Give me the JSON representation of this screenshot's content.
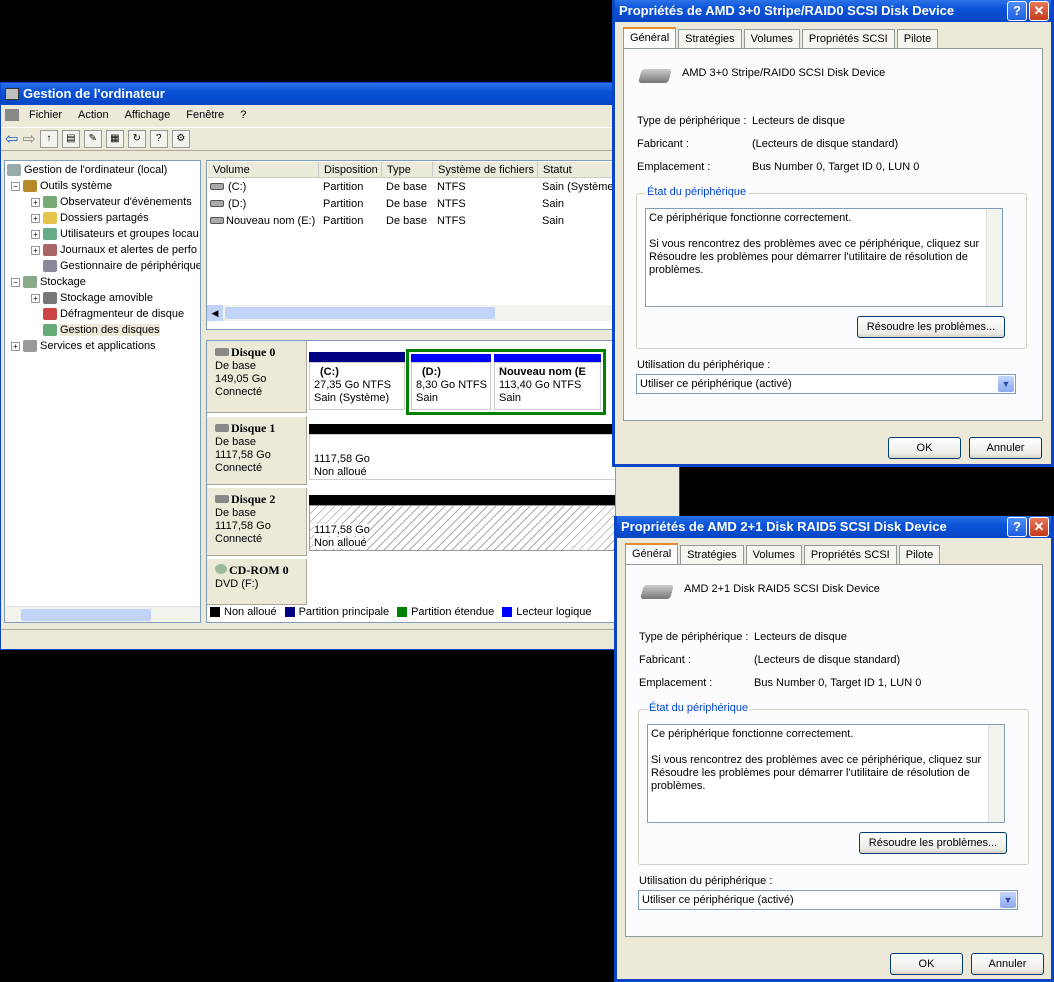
{
  "mmc": {
    "title": "Gestion de l'ordinateur",
    "menu": [
      "Fichier",
      "Action",
      "Affichage",
      "Fenêtre",
      "?"
    ],
    "tree": [
      {
        "label": "Gestion de l'ordinateur (local)",
        "level": 0,
        "expander": ""
      },
      {
        "label": "Outils système",
        "level": 1,
        "expander": "−"
      },
      {
        "label": "Observateur d'événements",
        "level": 2,
        "expander": "+"
      },
      {
        "label": "Dossiers partagés",
        "level": 2,
        "expander": "+"
      },
      {
        "label": "Utilisateurs et groupes locau",
        "level": 2,
        "expander": "+"
      },
      {
        "label": "Journaux et alertes de perfo",
        "level": 2,
        "expander": "+"
      },
      {
        "label": "Gestionnaire de périphérique",
        "level": 2,
        "expander": ""
      },
      {
        "label": "Stockage",
        "level": 1,
        "expander": "−"
      },
      {
        "label": "Stockage amovible",
        "level": 2,
        "expander": "+"
      },
      {
        "label": "Défragmenteur de disque",
        "level": 2,
        "expander": ""
      },
      {
        "label": "Gestion des disques",
        "level": 2,
        "expander": ""
      },
      {
        "label": "Services et applications",
        "level": 1,
        "expander": "+"
      }
    ],
    "columns": [
      "Volume",
      "Disposition",
      "Type",
      "Système de fichiers",
      "Statut"
    ],
    "volumes": [
      [
        "(C:)",
        "Partition",
        "De base",
        "NTFS",
        "Sain (Système)"
      ],
      [
        "(D:)",
        "Partition",
        "De base",
        "NTFS",
        "Sain"
      ],
      [
        "Nouveau nom (E:)",
        "Partition",
        "De base",
        "NTFS",
        "Sain"
      ]
    ],
    "disks": {
      "d0": {
        "name": "Disque 0",
        "type": "De base",
        "size": "149,05 Go",
        "state": "Connecté"
      },
      "d1": {
        "name": "Disque 1",
        "type": "De base",
        "size": "1117,58 Go",
        "state": "Connecté"
      },
      "d2": {
        "name": "Disque 2",
        "type": "De base",
        "size": "1117,58 Go",
        "state": "Connecté"
      },
      "cd": {
        "name": "CD-ROM 0",
        "type": "DVD (F:)"
      }
    },
    "parts": {
      "c": {
        "name": "(C:)",
        "size": "27,35 Go NTFS",
        "status": "Sain (Système)"
      },
      "d": {
        "name": "(D:)",
        "size": "8,30 Go NTFS",
        "status": "Sain"
      },
      "e": {
        "name": "Nouveau nom  (E",
        "size": "113,40 Go NTFS",
        "status": "Sain"
      },
      "u1": {
        "size": "1117,58 Go",
        "status": "Non alloué"
      },
      "u2": {
        "size": "1117,58 Go",
        "status": "Non alloué"
      }
    },
    "legend": [
      "Non alloué",
      "Partition principale",
      "Partition étendue",
      "Lecteur logique"
    ],
    "colors": {
      "unalloc": "#000000",
      "primary": "#000080",
      "extended": "#008000",
      "logical": "#0000ff"
    }
  },
  "dlg1": {
    "title": "Propriétés de AMD 3+0 Stripe/RAID0 SCSI Disk Device",
    "tabs": [
      "Général",
      "Stratégies",
      "Volumes",
      "Propriétés SCSI",
      "Pilote"
    ],
    "device": "AMD 3+0 Stripe/RAID0 SCSI Disk Device",
    "type_label": "Type de périphérique :",
    "type_value": "Lecteurs de disque",
    "mfr_label": "Fabricant :",
    "mfr_value": "(Lecteurs de disque standard)",
    "loc_label": "Emplacement :",
    "loc_value": "Bus Number 0, Target ID 0, LUN 0",
    "status_group": "État du périphérique",
    "status_line1": "Ce périphérique fonctionne correctement.",
    "status_line2": "Si vous rencontrez des problèmes avec ce périphérique, cliquez sur Résoudre les problèmes pour démarrer l'utilitaire de résolution de problèmes.",
    "troubleshoot": "Résoudre les problèmes...",
    "usage_label": "Utilisation du périphérique :",
    "usage_value": "Utiliser ce périphérique (activé)",
    "ok": "OK",
    "cancel": "Annuler"
  },
  "dlg2": {
    "title": "Propriétés de AMD 2+1 Disk RAID5 SCSI Disk Device",
    "tabs": [
      "Général",
      "Stratégies",
      "Volumes",
      "Propriétés SCSI",
      "Pilote"
    ],
    "device": "AMD 2+1 Disk RAID5 SCSI Disk Device",
    "type_label": "Type de périphérique :",
    "type_value": "Lecteurs de disque",
    "mfr_label": "Fabricant :",
    "mfr_value": "(Lecteurs de disque standard)",
    "loc_label": "Emplacement :",
    "loc_value": "Bus Number 0, Target ID 1, LUN 0",
    "status_group": "État du périphérique",
    "status_line1": "Ce périphérique fonctionne correctement.",
    "status_line2": "Si vous rencontrez des problèmes avec ce périphérique, cliquez sur Résoudre les problèmes pour démarrer l'utilitaire de résolution de problèmes.",
    "troubleshoot": "Résoudre les problèmes...",
    "usage_label": "Utilisation du périphérique :",
    "usage_value": "Utiliser ce périphérique (activé)",
    "ok": "OK",
    "cancel": "Annuler"
  },
  "icons": {
    "help": "?",
    "close": "✕"
  }
}
